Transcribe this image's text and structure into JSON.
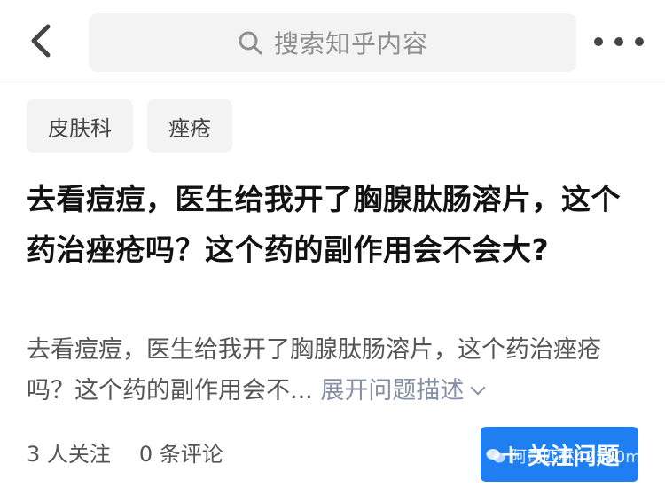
{
  "header": {
    "search_placeholder": "搜索知乎内容",
    "back_icon": "chevron-left-icon",
    "more_icon": "more-dots-icon"
  },
  "tags": [
    {
      "label": "皮肤科"
    },
    {
      "label": "痤疮"
    }
  ],
  "question": {
    "title": "去看痘痘，医生给我开了胸腺肽肠溶片，这个药治痤疮吗？这个药的副作用会不会大?",
    "description": "去看痘痘，医生给我开了胸腺肽肠溶片，这个药治痤疮吗？这个药的副作用会不...",
    "expand_label": "展开问题描述"
  },
  "stats": {
    "followers": "3 人关注",
    "comments": "0 条评论"
  },
  "follow_button": {
    "label": "关注问题",
    "plus": "+"
  },
  "watermark": {
    "text": "阿司匹林42180m"
  },
  "colors": {
    "accent": "#1f7ef2",
    "link": "#8590a6",
    "tag_bg": "#f3f3f3"
  }
}
